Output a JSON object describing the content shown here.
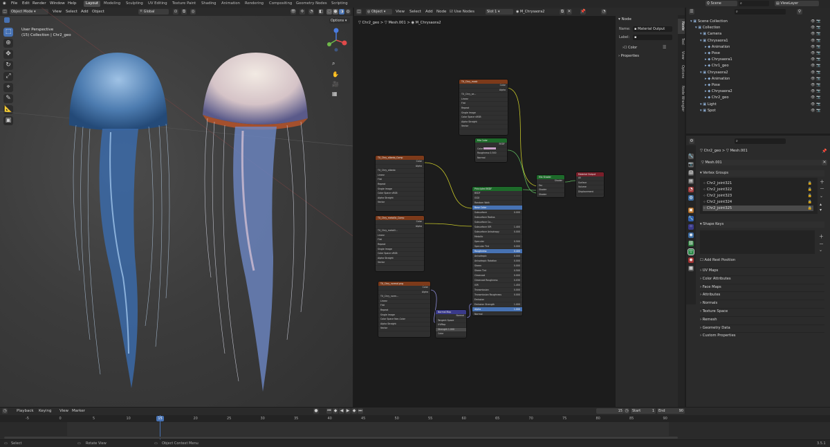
{
  "topbar": {
    "menus": [
      "File",
      "Edit",
      "Render",
      "Window",
      "Help"
    ],
    "workspaces": [
      "Layout",
      "Modeling",
      "Sculpting",
      "UV Editing",
      "Texture Paint",
      "Shading",
      "Animation",
      "Rendering",
      "Compositing",
      "Geometry Nodes",
      "Scripting"
    ],
    "active_workspace": "Layout",
    "scene": "Scene",
    "view_layer": "ViewLayer"
  },
  "viewport": {
    "mode": "Object Mode",
    "menus": [
      "View",
      "Select",
      "Add",
      "Object"
    ],
    "transform": "Global",
    "perspective": "User Perspective",
    "collection": "(15) Collection | Chr2_geo",
    "options": "Options"
  },
  "node_editor": {
    "type": "Object",
    "menus": [
      "View",
      "Select",
      "Add",
      "Node"
    ],
    "use_nodes": "Use Nodes",
    "slot": "Slot 1",
    "material": "M_Chrysaora2",
    "breadcrumb": [
      "Chr2_geo",
      "Mesh.001",
      "M_Chrysaora2"
    ],
    "nodes": {
      "tex_noise": {
        "title": "TX_Chry_mask",
        "out": [
          "Color",
          "Alpha"
        ],
        "img": "TX_Chry_se...",
        "rows": [
          "Linear",
          "Flat",
          "Repeat",
          "Single Image",
          "Color Space",
          "Alpha",
          "Vector"
        ],
        "vals": [
          "",
          "",
          "",
          "",
          "sRGB",
          "Straight",
          ""
        ]
      },
      "rgb": {
        "title": "Mix Color",
        "rows": [
          "BSDF",
          "Color",
          "Roughness",
          "Normal"
        ],
        "vals": [
          "",
          "",
          "0.500",
          ""
        ]
      },
      "albedo": {
        "title": "TX_Chry_albedo_Comp",
        "out": [
          "Color",
          "Alpha"
        ],
        "img": "TX_Chry_albedo",
        "rows": [
          "Linear",
          "Flat",
          "Repeat",
          "Single Image",
          "Color Space",
          "Alpha",
          "Vector"
        ],
        "vals": [
          "",
          "",
          "",
          "",
          "sRGB",
          "Straight",
          ""
        ]
      },
      "metal": {
        "title": "TX_Chry_metallic_Comp",
        "out": [
          "Color",
          "Alpha"
        ],
        "img": "TX_Chry_metalli...",
        "rows": [
          "Linear",
          "Flat",
          "Repeat",
          "Single Image",
          "Color Space",
          "Alpha",
          "Vector"
        ],
        "vals": [
          "",
          "",
          "",
          "",
          "sRGB",
          "Straight",
          ""
        ]
      },
      "normaltex": {
        "title": "TX_Chry_normal.png",
        "out": [
          "Color",
          "Alpha"
        ],
        "img": "TX_Chry_norm...",
        "rows": [
          "Linear",
          "Flat",
          "Repeat",
          "Single Image",
          "Color Space",
          "Alpha",
          "Vector"
        ],
        "vals": [
          "",
          "",
          "",
          "",
          "Non-Color",
          "Straight",
          ""
        ]
      },
      "normalmap": {
        "title": "Normal Map",
        "rows": [
          "Normal",
          "Tangent Space",
          "UVMap",
          "Strength",
          "Color"
        ],
        "vals": [
          "",
          "",
          "",
          "1.000",
          ""
        ]
      },
      "bsdf": {
        "title": "Principled BSDF",
        "rows": [
          "BSDF",
          "GGX",
          "Random Walk",
          "Base Color",
          "Subsurface",
          "Subsurface Radius",
          "Subsurface Co...",
          "Subsurface IOR",
          "Subsurface Anisotropy",
          "Metallic",
          "Specular",
          "Specular Tint",
          "Roughness",
          "Anisotropic",
          "Anisotropic Rotation",
          "Sheen",
          "Sheen Tint",
          "Clearcoat",
          "Clearcoat Roughness",
          "IOR",
          "Transmission",
          "Transmission Roughness",
          "Emission",
          "Emission Strength",
          "Alpha",
          "Normal",
          "Clearcoat Normal",
          "Tangent"
        ],
        "vals": [
          "",
          "",
          "",
          "",
          "0.000",
          "",
          "",
          "1.400",
          "0.000",
          "",
          "0.500",
          "0.000",
          "0.400",
          "0.000",
          "0.000",
          "0.000",
          "0.500",
          "0.000",
          "0.030",
          "1.450",
          "0.000",
          "0.000",
          "",
          "1.000",
          "1.000",
          "",
          "",
          ""
        ]
      },
      "mix": {
        "title": "Mix Shader",
        "rows": [
          "Shader",
          "Fac",
          "Shader",
          "Shader"
        ],
        "vals": [
          "",
          "",
          "",
          ""
        ]
      },
      "output": {
        "title": "Material Output",
        "rows": [
          "All",
          "Surface",
          "Volume",
          "Displacement"
        ],
        "vals": [
          "",
          "",
          "",
          ""
        ]
      }
    }
  },
  "node_sidebar": {
    "panel": "Node",
    "name_label": "Name:",
    "name_value": "Material Output",
    "label_label": "Label:",
    "color": "Color",
    "properties": "Properties",
    "tabs": [
      "Node",
      "Tool",
      "View",
      "Options",
      "Node Wrangler"
    ]
  },
  "outliner": {
    "items": [
      {
        "label": "Scene Collection",
        "indent": 0
      },
      {
        "label": "Collection",
        "indent": 1
      },
      {
        "label": "Camera",
        "indent": 2
      },
      {
        "label": "Chrysaora1",
        "indent": 2
      },
      {
        "label": "Animation",
        "indent": 3
      },
      {
        "label": "Pose",
        "indent": 3
      },
      {
        "label": "Chrysaora1",
        "indent": 3
      },
      {
        "label": "Chr1_geo",
        "indent": 3
      },
      {
        "label": "Chrysaora2",
        "indent": 2
      },
      {
        "label": "Animation",
        "indent": 3
      },
      {
        "label": "Pose",
        "indent": 3
      },
      {
        "label": "Chrysaora2",
        "indent": 3
      },
      {
        "label": "Chr2_geo",
        "indent": 3
      },
      {
        "label": "Light",
        "indent": 2
      },
      {
        "label": "Spot",
        "indent": 2
      }
    ]
  },
  "properties": {
    "breadcrumb": [
      "Chr2_geo",
      "Mesh.001"
    ],
    "mesh_name": "Mesh.001",
    "vertex_groups_title": "Vertex Groups",
    "vertex_groups": [
      "Chr2_joint321",
      "Chr2_joint322",
      "Chr2_joint323",
      "Chr2_joint324",
      "Chr2_joint325"
    ],
    "shape_keys": "Shape Keys",
    "add_rest": "Add Rest Position",
    "sections": [
      "UV Maps",
      "Color Attributes",
      "Face Maps",
      "Attributes",
      "Normals",
      "Texture Space",
      "Remesh",
      "Geometry Data",
      "Custom Properties"
    ]
  },
  "timeline": {
    "menus": [
      "Playback",
      "Keying",
      "View",
      "Marker"
    ],
    "current_frame": "15",
    "start_label": "Start",
    "start": "1",
    "end_label": "End",
    "end": "90",
    "ticks": [
      "-5",
      "0",
      "5",
      "10",
      "15",
      "20",
      "25",
      "30",
      "35",
      "40",
      "45",
      "50",
      "55",
      "60",
      "65",
      "70",
      "75",
      "80",
      "85",
      "90"
    ]
  },
  "status": {
    "select": "Select",
    "rotate": "Rotate View",
    "context": "Object Context Menu",
    "version": "3.5.1"
  }
}
